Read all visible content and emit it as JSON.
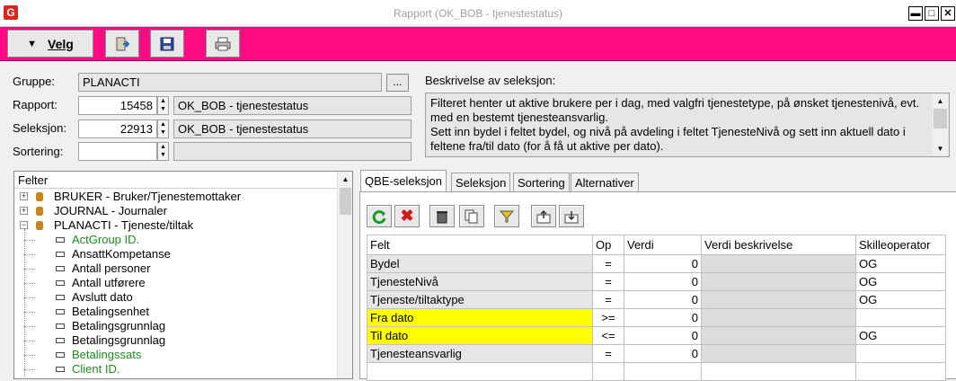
{
  "window": {
    "title": "Rapport (OK_BOB - tjenestestatus)",
    "app_icon": "G",
    "controls": [
      "▬",
      "□",
      "✕"
    ]
  },
  "toolbar": {
    "velg_label": "Velg",
    "buttons": [
      "exit-icon",
      "save-icon",
      "print-icon"
    ],
    "accent": "#ff0a82"
  },
  "form": {
    "gruppe_label": "Gruppe:",
    "gruppe_value": "PLANACTI",
    "browse_label": "...",
    "rapport_label": "Rapport:",
    "rapport_id": "15458",
    "rapport_name": "OK_BOB - tjenestestatus",
    "seleksjon_label": "Seleksjon:",
    "seleksjon_id": "22913",
    "seleksjon_name": "OK_BOB - tjenestestatus",
    "sortering_label": "Sortering:",
    "sortering_id": "",
    "sortering_name": ""
  },
  "description": {
    "label": "Beskrivelse av seleksjon:",
    "text": "Filteret henter ut aktive brukere per i dag, med valgfri tjenestetype, på ønsket tjenestenivå, evt. med en bestemt tjenesteansvarlig.\nSett inn bydel i feltet bydel, og nivå på avdeling i feltet TjenesteNivå og sett inn aktuell dato i feltene fra/til dato (for å få ut aktive per dato)."
  },
  "tree": {
    "header": "Felter",
    "groups": [
      {
        "label": "BRUKER - Bruker/Tjenestemottaker",
        "expanded": false
      },
      {
        "label": "JOURNAL - Journaler",
        "expanded": false
      },
      {
        "label": "PLANACTI - Tjeneste/tiltak",
        "expanded": true
      }
    ],
    "fields": [
      {
        "label": "ActGroup ID.",
        "green": true
      },
      {
        "label": "AnsattKompetanse",
        "green": false
      },
      {
        "label": "Antall personer",
        "green": false
      },
      {
        "label": "Antall utførere",
        "green": false
      },
      {
        "label": "Avslutt dato",
        "green": false
      },
      {
        "label": "Betalingsenhet",
        "green": false
      },
      {
        "label": "Betalingsgrunnlag",
        "green": false
      },
      {
        "label": "Betalingsgrunnlag",
        "green": false
      },
      {
        "label": "Betalingssats",
        "green": true
      },
      {
        "label": "Client ID.",
        "green": true
      }
    ]
  },
  "tabs": [
    {
      "label": "QBE-seleksjon",
      "active": true
    },
    {
      "label": "Seleksjon",
      "active": false
    },
    {
      "label": "Sortering",
      "active": false
    },
    {
      "label": "Alternativer",
      "active": false
    }
  ],
  "grid_toolbar": [
    "refresh-icon",
    "delete-icon",
    "trash-icon",
    "copy-icon",
    "filter-icon",
    "import-icon",
    "export-icon"
  ],
  "grid": {
    "columns": [
      "Felt",
      "Op",
      "Verdi",
      "Verdi beskrivelse",
      "Skilleoperator"
    ],
    "rows": [
      {
        "felt": "Bydel",
        "op": "=",
        "verdi": "0",
        "beskrivelse": "",
        "skille": "OG",
        "highlight": false
      },
      {
        "felt": "TjenesteNivå",
        "op": "=",
        "verdi": "0",
        "beskrivelse": "",
        "skille": "OG",
        "highlight": false
      },
      {
        "felt": "Tjeneste/tiltaktype",
        "op": "=",
        "verdi": "0",
        "beskrivelse": "",
        "skille": "OG",
        "highlight": false
      },
      {
        "felt": "Fra dato",
        "op": ">=",
        "verdi": "0",
        "beskrivelse": "",
        "skille": "",
        "highlight": true
      },
      {
        "felt": "Til dato",
        "op": "<=",
        "verdi": "0",
        "beskrivelse": "",
        "skille": "OG",
        "highlight": true
      },
      {
        "felt": "Tjenesteansvarlig",
        "op": "=",
        "verdi": "0",
        "beskrivelse": "",
        "skille": "",
        "highlight": false
      }
    ]
  }
}
